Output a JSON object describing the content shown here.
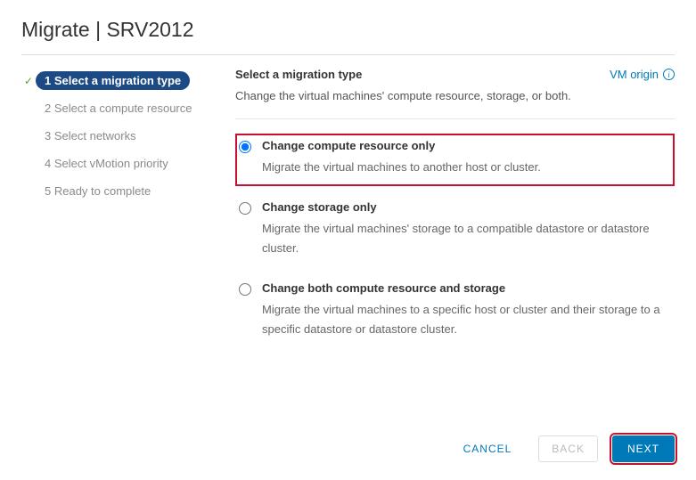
{
  "title": "Migrate | SRV2012",
  "sidebar": {
    "steps": [
      {
        "label": "1 Select a migration type",
        "active": true
      },
      {
        "label": "2 Select a compute resource",
        "active": false
      },
      {
        "label": "3 Select networks",
        "active": false
      },
      {
        "label": "4 Select vMotion priority",
        "active": false
      },
      {
        "label": "5 Ready to complete",
        "active": false
      }
    ]
  },
  "main": {
    "heading": "Select a migration type",
    "description": "Change the virtual machines' compute resource, storage, or both.",
    "vm_origin_label": "VM origin",
    "options": [
      {
        "title": "Change compute resource only",
        "desc": "Migrate the virtual machines to another host or cluster.",
        "selected": true,
        "highlighted": true
      },
      {
        "title": "Change storage only",
        "desc": "Migrate the virtual machines' storage to a compatible datastore or datastore cluster.",
        "selected": false,
        "highlighted": false
      },
      {
        "title": "Change both compute resource and storage",
        "desc": "Migrate the virtual machines to a specific host or cluster and their storage to a specific datastore or datastore cluster.",
        "selected": false,
        "highlighted": false
      }
    ]
  },
  "footer": {
    "cancel": "CANCEL",
    "back": "BACK",
    "next": "NEXT"
  }
}
